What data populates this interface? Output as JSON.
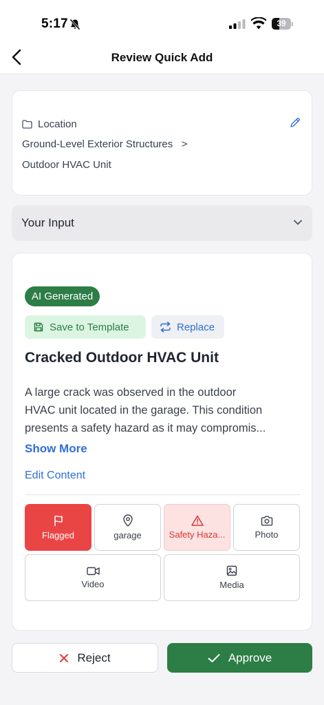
{
  "status_bar": {
    "time": "5:17",
    "battery": "39",
    "battery_fraction": 0.39
  },
  "header": {
    "title": "Review Quick Add"
  },
  "location": {
    "label": "Location",
    "path_line_1": "Ground-Level Exterior Structures   >",
    "path_line_2": "Outdoor HVAC Unit"
  },
  "your_input": {
    "title": "Your Input"
  },
  "item": {
    "badge": "AI Generated",
    "save_template": "Save to Template",
    "replace": "Replace",
    "title": "Cracked Outdoor HVAC Unit",
    "description_lines": [
      "A large crack was observed in the outdoor",
      "HVAC unit located in the garage. This condition",
      "presents a safety hazard as it may compromis..."
    ],
    "show_more": "Show More",
    "edit_content": "Edit Content"
  },
  "tiles": [
    {
      "label": "Flagged",
      "icon": "flag-icon"
    },
    {
      "label": "garage",
      "icon": "map-pin-icon"
    },
    {
      "label": "Safety Haza...",
      "icon": "warning-icon"
    },
    {
      "label": "Photo",
      "icon": "camera-icon"
    },
    {
      "label": "Video",
      "icon": "video-icon"
    },
    {
      "label": "Media",
      "icon": "image-icon"
    }
  ],
  "actions": {
    "reject": "Reject",
    "approve": "Approve"
  },
  "colors": {
    "primary_green": "#2d7d46",
    "link_blue": "#2f6fd6",
    "flag_red": "#ea4545",
    "hazard_bg": "#fde2e2"
  }
}
